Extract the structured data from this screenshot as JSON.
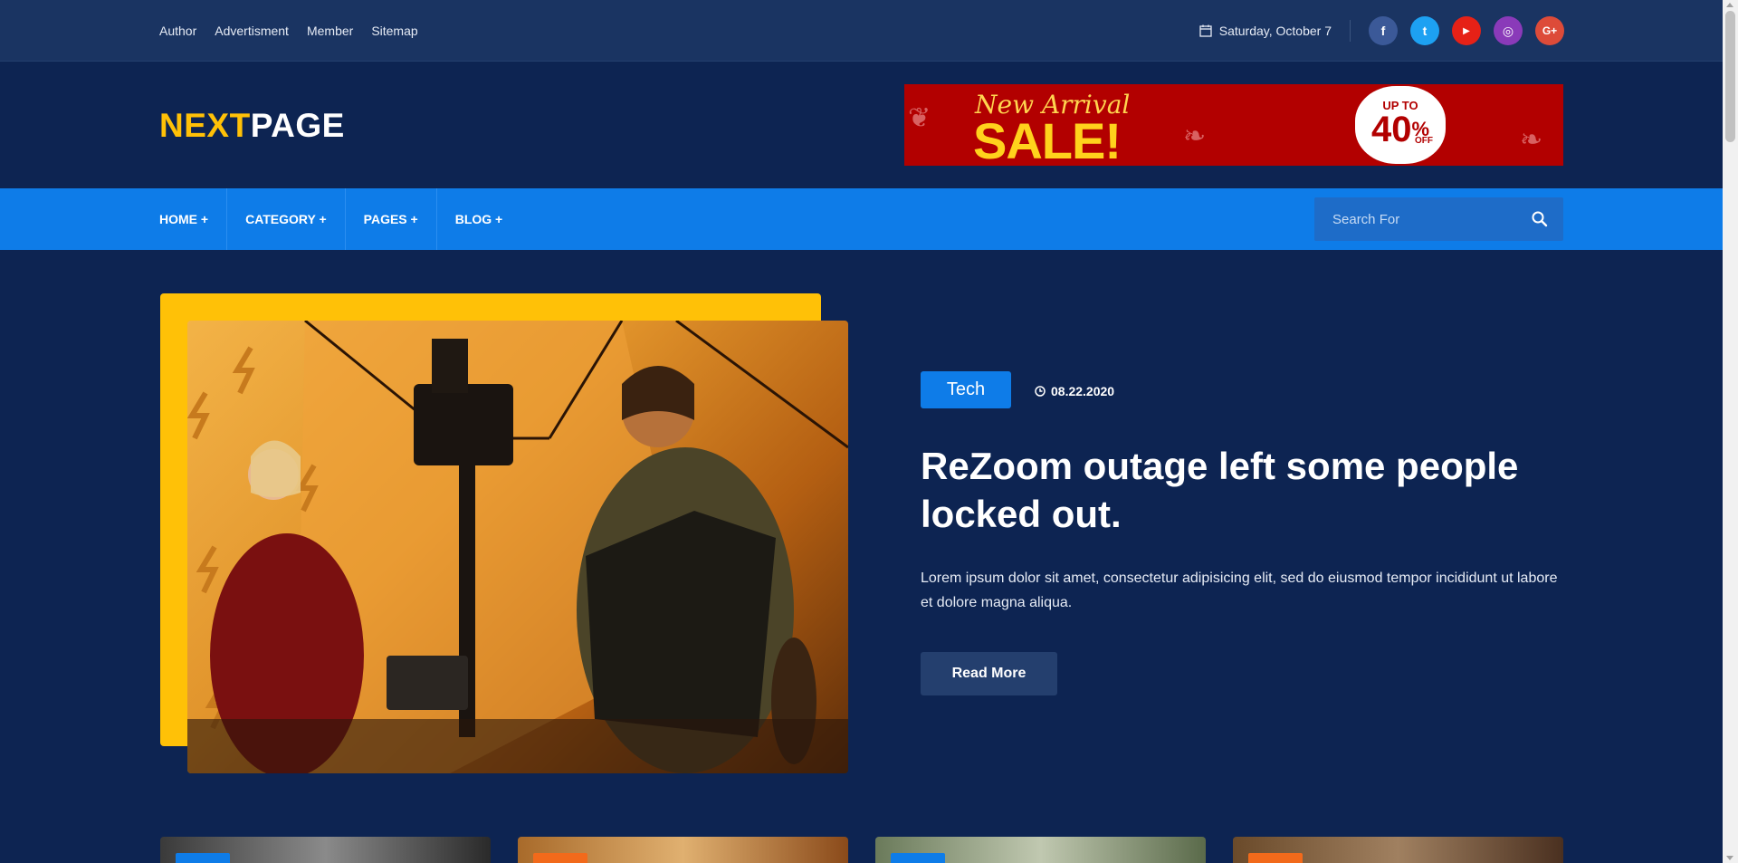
{
  "topbar": {
    "links": [
      "Author",
      "Advertisment",
      "Member",
      "Sitemap"
    ],
    "date": "Saturday, October 7",
    "social": [
      {
        "icon": "facebook-icon",
        "glyph": "f",
        "color": "#3b5998"
      },
      {
        "icon": "twitter-icon",
        "glyph": "t",
        "color": "#1da1f2"
      },
      {
        "icon": "youtube-icon",
        "glyph": "▶",
        "color": "#e62117"
      },
      {
        "icon": "instagram-icon",
        "glyph": "◎",
        "color": "#8a3ab9"
      },
      {
        "icon": "google-plus-icon",
        "glyph": "G+",
        "color": "#dd4b39"
      }
    ]
  },
  "header": {
    "logo_part1": "NEXT",
    "logo_part2": "PAGE",
    "banner": {
      "line1": "New Arrival",
      "line2": "SALE!",
      "badge_top": "UP TO",
      "badge_value": "40",
      "badge_percent": "%",
      "badge_bottom": "OFF"
    }
  },
  "nav": {
    "items": [
      "HOME +",
      "CATEGORY +",
      "PAGES +",
      "BLOG +"
    ],
    "search_placeholder": "Search For"
  },
  "hero": {
    "tag": "Tech",
    "date": "08.22.2020",
    "title": "ReZoom outage left some people locked out.",
    "excerpt": "Lorem ipsum dolor sit amet, consectetur adipisicing elit, sed do eiusmod tempor incididunt ut labore et dolore magna aliqua.",
    "read_more": "Read More"
  },
  "colors": {
    "accent_yellow": "#ffc107",
    "nav_blue": "#0e7ce8",
    "page_bg": "#0d2452"
  }
}
